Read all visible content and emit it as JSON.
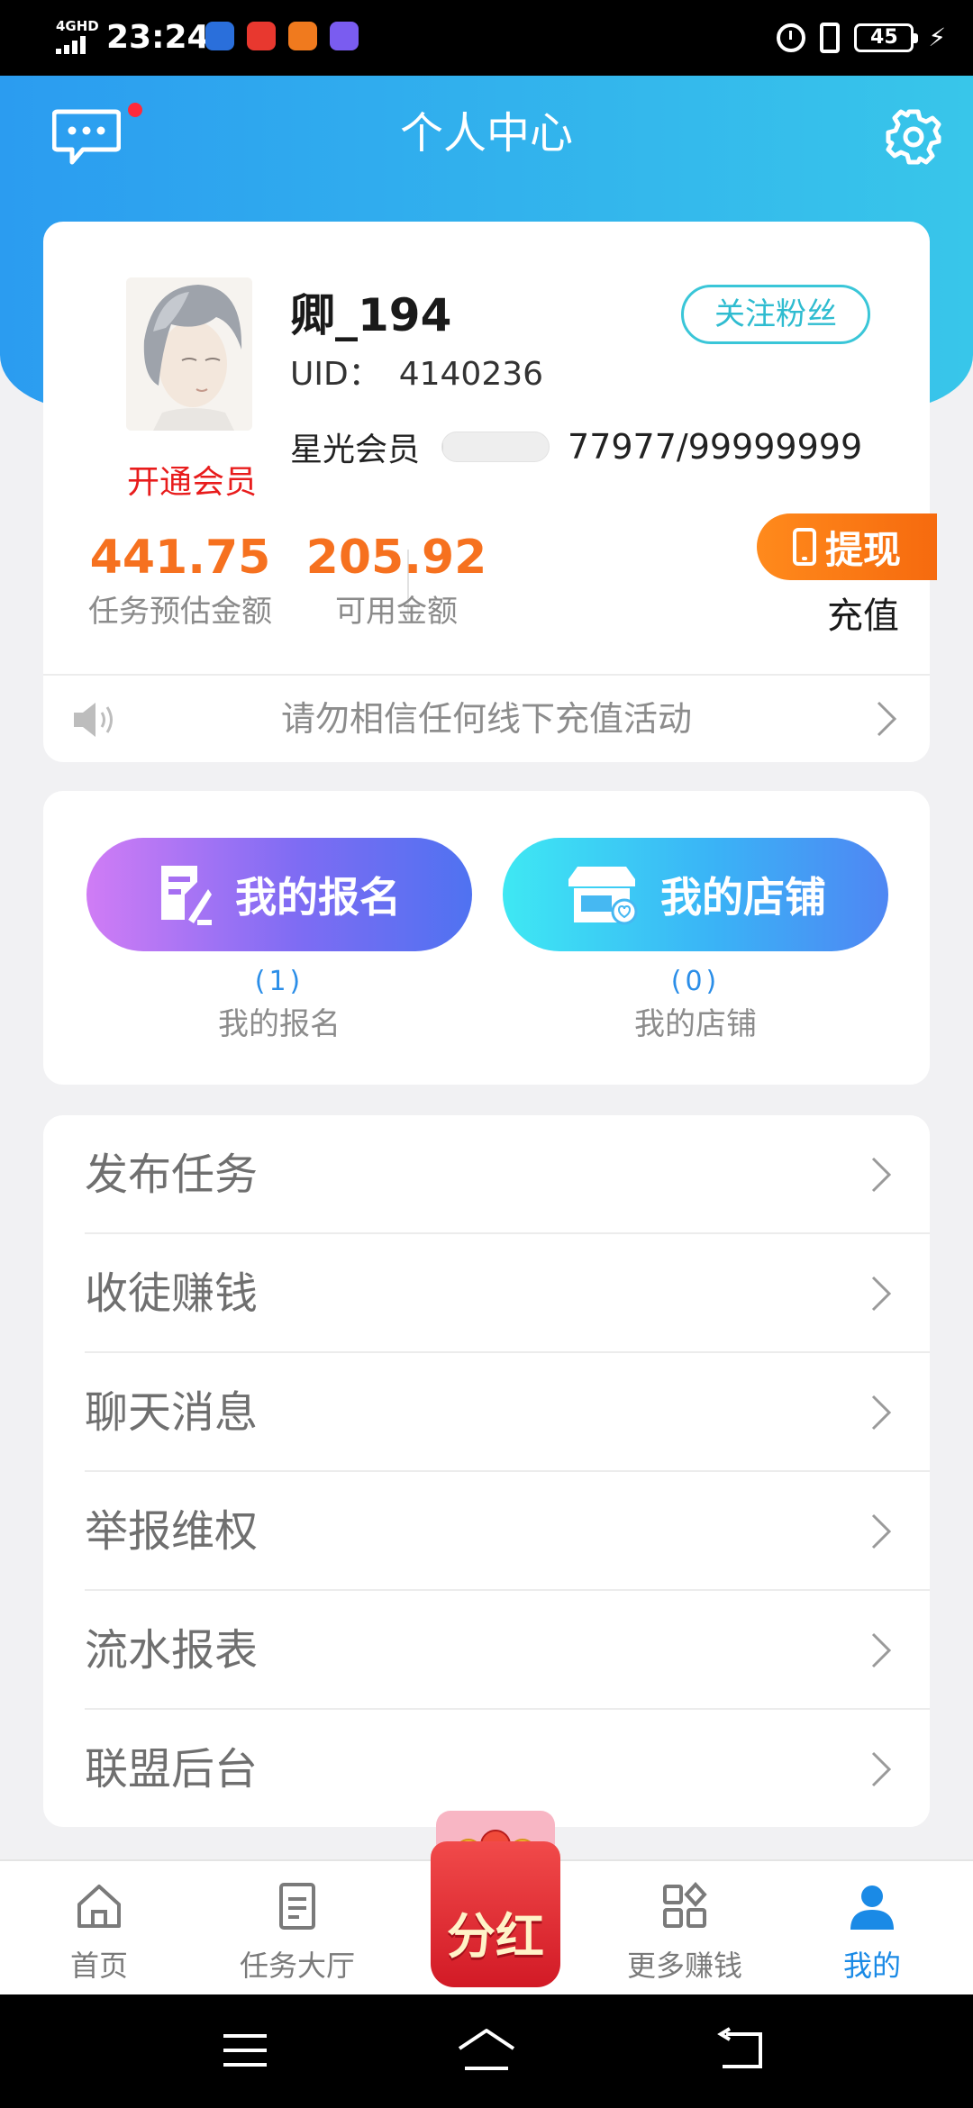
{
  "status_bar": {
    "network": "4GHD",
    "time": "23:24",
    "battery": "45",
    "app_icon_colors": [
      "#2a6fdb",
      "#e8382f",
      "#f07a1e",
      "#7a5cf0"
    ]
  },
  "header": {
    "title": "个人中心",
    "gradient": [
      "#2b9cf0",
      "#38c6ea"
    ],
    "has_unread": true
  },
  "profile": {
    "username": "卿_194",
    "uid_label": "UID：",
    "uid_value": "4140236",
    "follow_label": "关注粉丝",
    "vip_link": "开通会员",
    "star_label": "星光会员",
    "star_value": "77977/99999999",
    "star_progress": 0.0008,
    "task_amount": "441.75",
    "task_amount_label": "任务预估金额",
    "available_amount": "205.92",
    "available_amount_label": "可用金额",
    "withdraw_label": "提现",
    "recharge_label": "充值",
    "notice": "请勿相信任何线下充值活动"
  },
  "quick": {
    "signup": {
      "label": "我的报名",
      "count": "(1)",
      "caption": "我的报名"
    },
    "shop": {
      "label": "我的店铺",
      "count": "(0)",
      "caption": "我的店铺"
    }
  },
  "menu": [
    {
      "label": "发布任务"
    },
    {
      "label": "收徒赚钱"
    },
    {
      "label": "聊天消息"
    },
    {
      "label": "举报维权"
    },
    {
      "label": "流水报表"
    },
    {
      "label": "联盟后台"
    }
  ],
  "bottom_nav": {
    "home": "首页",
    "tasks": "任务大厅",
    "bonus": "分红",
    "more": "更多赚钱",
    "mine": "我的",
    "active": "mine",
    "accent_color": "#1a8ae6"
  },
  "icons": {
    "message": "chat-bubble-icon",
    "settings": "gear-icon",
    "speaker": "speaker-icon",
    "withdraw": "phone-icon"
  }
}
